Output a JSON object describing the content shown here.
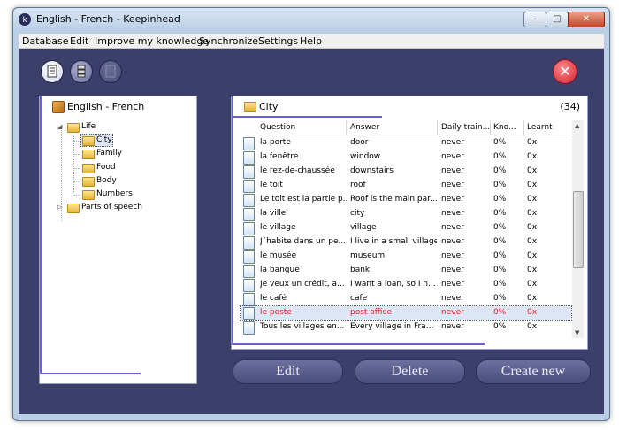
{
  "window": {
    "title": "English - French - Keepinhead"
  },
  "menu": [
    "Database",
    "Edit",
    "Improve my knowledge",
    "Synchronize",
    "Settings",
    "Help"
  ],
  "tree": {
    "root": "English - French",
    "nodes": [
      {
        "label": "Life"
      },
      {
        "label": "City"
      },
      {
        "label": "Family"
      },
      {
        "label": "Food"
      },
      {
        "label": "Body"
      },
      {
        "label": "Numbers"
      },
      {
        "label": "Parts of speech"
      }
    ]
  },
  "list": {
    "title": "City",
    "count": "(34)",
    "columns": [
      "Question",
      "Answer",
      "Daily train...",
      "Kno...",
      "Learnt"
    ],
    "rows": [
      {
        "q": "la porte",
        "a": "door",
        "d": "never",
        "k": "0%",
        "l": "0x"
      },
      {
        "q": "la fenêtre",
        "a": "window",
        "d": "never",
        "k": "0%",
        "l": "0x"
      },
      {
        "q": "le rez-de-chaussée",
        "a": "downstairs",
        "d": "never",
        "k": "0%",
        "l": "0x"
      },
      {
        "q": "le toit",
        "a": "roof",
        "d": "never",
        "k": "0%",
        "l": "0x"
      },
      {
        "q": "Le toit est la partie p...",
        "a": "Roof is the main par...",
        "d": "never",
        "k": "0%",
        "l": "0x"
      },
      {
        "q": "la ville",
        "a": "city",
        "d": "never",
        "k": "0%",
        "l": "0x"
      },
      {
        "q": "le village",
        "a": "village",
        "d": "never",
        "k": "0%",
        "l": "0x"
      },
      {
        "q": "J´habite dans un pe...",
        "a": "I live in a small village.",
        "d": "never",
        "k": "0%",
        "l": "0x"
      },
      {
        "q": "le musée",
        "a": "museum",
        "d": "never",
        "k": "0%",
        "l": "0x"
      },
      {
        "q": "la banque",
        "a": "bank",
        "d": "never",
        "k": "0%",
        "l": "0x"
      },
      {
        "q": "Je veux un crédit, a...",
        "a": "I want a loan, so I n...",
        "d": "never",
        "k": "0%",
        "l": "0x"
      },
      {
        "q": "le café",
        "a": "cafe",
        "d": "never",
        "k": "0%",
        "l": "0x"
      },
      {
        "q": "le poste",
        "a": "post office",
        "d": "never",
        "k": "0%",
        "l": "0x"
      },
      {
        "q": "Tous les villages en...",
        "a": "Every village in Fra...",
        "d": "never",
        "k": "0%",
        "l": "0x"
      }
    ],
    "selected_index": 12
  },
  "buttons": {
    "edit": "Edit",
    "delete": "Delete",
    "create": "Create new"
  }
}
